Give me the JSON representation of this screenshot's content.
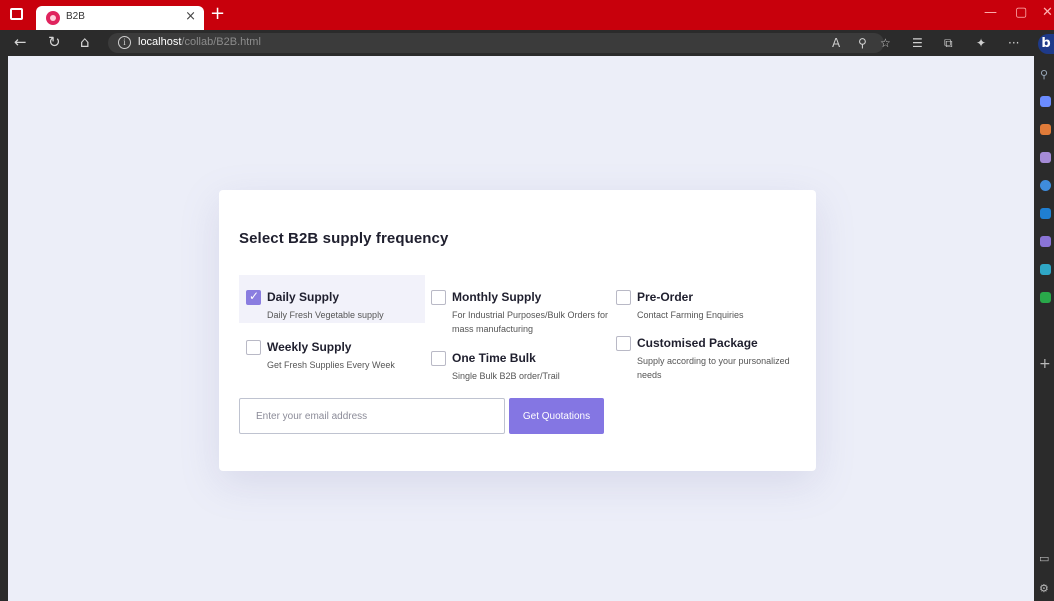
{
  "browser": {
    "tab_title": "B2B",
    "tab_close": "×",
    "new_tab": "+",
    "url_host": "localhost",
    "url_path": "/collab/B2B.html",
    "bing_label": "b",
    "accent_color": "#c8000c"
  },
  "page": {
    "title": "Select B2B supply frequency",
    "options": [
      {
        "label": "Daily Supply",
        "description": "Daily Fresh Vegetable supply",
        "checked": true
      },
      {
        "label": "Monthly Supply",
        "description": "For Industrial Purposes/Bulk Orders for mass manufacturing",
        "checked": false
      },
      {
        "label": "Pre-Order",
        "description": "Contact Farming Enquiries",
        "checked": false
      },
      {
        "label": "Weekly Supply",
        "description": "Get Fresh Supplies Every Week",
        "checked": false
      },
      {
        "label": "One Time Bulk",
        "description": "Single Bulk B2B order/Trail",
        "checked": false
      },
      {
        "label": "Customised Package",
        "description": "Supply according to your pursonalized needs",
        "checked": false
      }
    ],
    "email_placeholder": "Enter your email address",
    "quote_button_label": "Get Quotations",
    "check_mark": "✓",
    "primary_color": "#8476e3"
  }
}
